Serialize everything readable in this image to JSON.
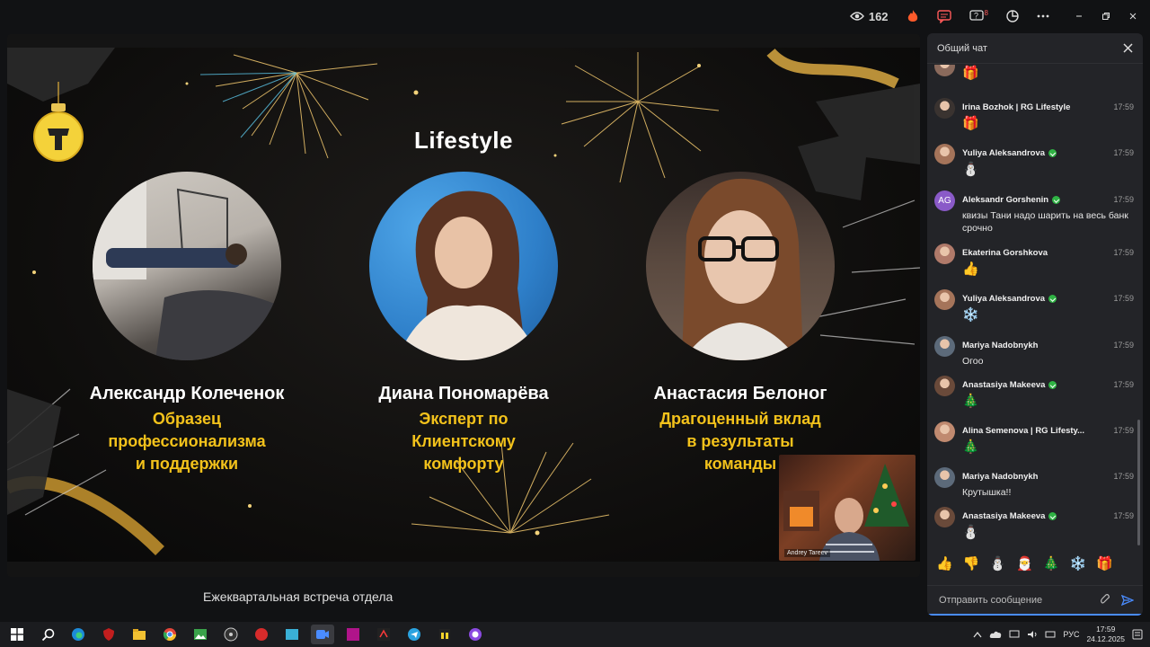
{
  "topbar": {
    "viewers": "162",
    "notif_badge": "8"
  },
  "slide": {
    "title": "Lifestyle",
    "people": [
      {
        "name": "Александр Колеченок",
        "role_lines": [
          "Образец",
          "профессионализма",
          "и поддержки"
        ]
      },
      {
        "name": "Диана  Пономарёва",
        "role_lines": [
          "Эксперт по",
          "Клиентскому",
          "комфорту"
        ]
      },
      {
        "name": "Анастасия Белоног",
        "role_lines": [
          "Драгоценный вклад",
          "в результаты",
          "команды"
        ]
      }
    ],
    "logo_letter": "T"
  },
  "webcam": {
    "name": "Andrey Tareev"
  },
  "caption": "Ежеквартальная встреча отдела",
  "chat": {
    "title": "Общий чат",
    "messages": [
      {
        "author": "",
        "time": "",
        "verified": false,
        "emoji": "🎁",
        "text": ""
      },
      {
        "author": "Irina Bozhok | RG Lifestyle",
        "time": "17:59",
        "verified": false,
        "emoji": "🎁",
        "text": ""
      },
      {
        "author": "Yuliya Aleksandrova",
        "time": "17:59",
        "verified": true,
        "emoji": "⛄",
        "text": ""
      },
      {
        "author": "Aleksandr Gorshenin",
        "time": "17:59",
        "verified": true,
        "emoji": "",
        "text": "квизы Тани надо шарить на весь банк срочно",
        "initials": "AG"
      },
      {
        "author": "Ekaterina Gorshkova",
        "time": "17:59",
        "verified": false,
        "emoji": "👍",
        "text": ""
      },
      {
        "author": "Yuliya Aleksandrova",
        "time": "17:59",
        "verified": true,
        "emoji": "❄️",
        "text": ""
      },
      {
        "author": "Mariya Nadobnykh",
        "time": "17:59",
        "verified": false,
        "emoji": "",
        "text": "Огоо"
      },
      {
        "author": "Anastasiya Makeeva",
        "time": "17:59",
        "verified": true,
        "emoji": "🎄",
        "text": ""
      },
      {
        "author": "Alina Semenova | RG Lifesty...",
        "time": "17:59",
        "verified": false,
        "emoji": "🎄",
        "text": ""
      },
      {
        "author": "Mariya Nadobnykh",
        "time": "17:59",
        "verified": false,
        "emoji": "",
        "text": "Крутышка!!"
      },
      {
        "author": "Anastasiya Makeeva",
        "time": "17:59",
        "verified": true,
        "emoji": "⛄",
        "text": ""
      }
    ],
    "reactions": [
      "👍",
      "👎",
      "⛄",
      "🎅",
      "🎄",
      "❄️",
      "🎁"
    ],
    "input_placeholder": "Отправить сообщение"
  },
  "taskbar": {
    "lang": "РУС",
    "time": "17:59",
    "date": "24.12.2025"
  },
  "colors": {
    "accent_yellow": "#f3c21b",
    "verified": "#2fb344",
    "send": "#4a8cff"
  }
}
